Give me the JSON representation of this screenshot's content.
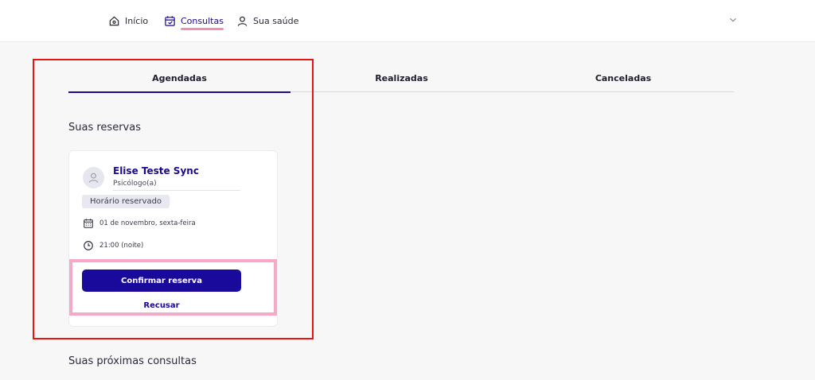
{
  "nav": {
    "items": [
      {
        "label": "Início",
        "icon": "home-icon"
      },
      {
        "label": "Consultas",
        "icon": "calendar-consult-icon",
        "active": true
      },
      {
        "label": "Sua saúde",
        "icon": "user-icon"
      }
    ],
    "menu_icon": "chevron-down-icon"
  },
  "tabs": [
    {
      "label": "Agendadas",
      "active": true
    },
    {
      "label": "Realizadas"
    },
    {
      "label": "Canceladas"
    }
  ],
  "reservations": {
    "title": "Suas reservas",
    "card": {
      "name": "Elise Teste Sync",
      "role": "Psicólogo(a)",
      "status": "Horário reservado",
      "date": "01 de novembro, sexta-feira",
      "time": "21:00 (noite)",
      "confirm_label": "Confirmar reserva",
      "decline_label": "Recusar"
    }
  },
  "upcoming": {
    "title": "Suas próximas consultas"
  },
  "colors": {
    "accent": "#1a0a9c",
    "nav_underline": "#f08fb4",
    "annotation_red": "#e8140f",
    "annotation_pink": "#f5a9c8"
  }
}
